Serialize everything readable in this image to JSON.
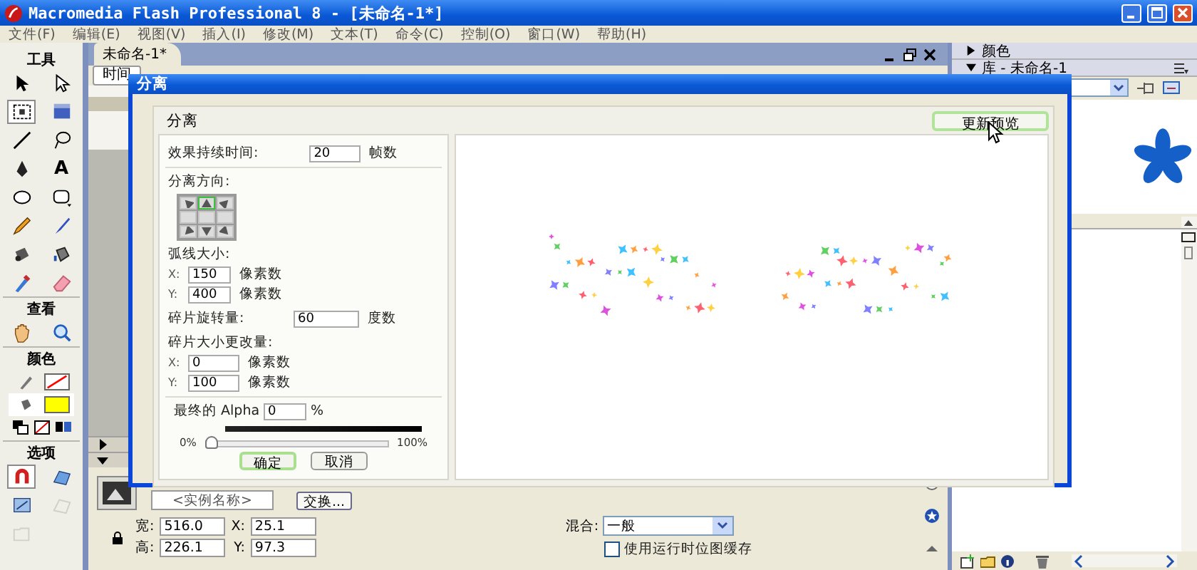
{
  "window": {
    "title": "Macromedia Flash Professional 8 - [未命名-1*]"
  },
  "menu": [
    "文件(F)",
    "编辑(E)",
    "视图(V)",
    "插入(I)",
    "修改(M)",
    "文本(T)",
    "命令(C)",
    "控制(O)",
    "窗口(W)",
    "帮助(H)"
  ],
  "tools": {
    "title": "工具",
    "items": [
      {
        "kind": "arrow",
        "selected": false
      },
      {
        "kind": "subselect",
        "selected": false
      },
      {
        "kind": "transform",
        "selected": true
      },
      {
        "kind": "gradient",
        "selected": false
      },
      {
        "kind": "line",
        "selected": false
      },
      {
        "kind": "lasso",
        "selected": false
      },
      {
        "kind": "pen",
        "selected": false
      },
      {
        "kind": "text",
        "glyph": "A",
        "selected": false
      },
      {
        "kind": "oval",
        "selected": false
      },
      {
        "kind": "polystar",
        "selected": false
      },
      {
        "kind": "pencil",
        "selected": false
      },
      {
        "kind": "brush",
        "selected": false
      },
      {
        "kind": "inkbottle",
        "selected": false
      },
      {
        "kind": "bucket",
        "selected": false
      },
      {
        "kind": "eyedropper",
        "selected": false
      },
      {
        "kind": "eraser",
        "selected": false
      }
    ],
    "view_title": "查看",
    "view_items": [
      {
        "kind": "hand",
        "selected": false
      },
      {
        "kind": "zoom",
        "selected": false
      }
    ],
    "color_title": "颜色",
    "swatches": [
      {
        "kind": "stroke",
        "color": "#ff0000"
      },
      {
        "kind": "fill",
        "color": "#ffff00"
      }
    ],
    "options_title": "选项",
    "options": [
      {
        "kind": "magnet",
        "selected": true,
        "disabled": false
      },
      {
        "kind": "smooth",
        "selected": false,
        "disabled": false
      },
      {
        "kind": "straighten",
        "selected": false,
        "disabled": false
      },
      {
        "kind": "shape",
        "selected": false,
        "disabled": true
      },
      {
        "kind": "folder",
        "selected": false,
        "disabled": true
      }
    ]
  },
  "document": {
    "tab": "未命名-1*",
    "timeline_button": "时间"
  },
  "properties": {
    "instance_placeholder": "<实例名称>",
    "swap_button": "交换...",
    "size_fields": [
      {
        "label": "宽:",
        "value": "516.0"
      },
      {
        "label": "X:",
        "value": "25.1"
      },
      {
        "label": "高:",
        "value": "226.1"
      },
      {
        "label": "Y:",
        "value": "97.3"
      }
    ],
    "blend_label": "混合:",
    "blend_value": "一般",
    "cache_checkbox": {
      "label": "使用运行时位图缓存",
      "checked": false
    }
  },
  "panels": [
    {
      "title": "颜色",
      "expanded": false
    },
    {
      "title": "库 - 未命名-1",
      "expanded": true
    }
  ],
  "dialog": {
    "title": "分离",
    "heading": "分离",
    "update_button": "更新预览",
    "duration": {
      "label": "效果持续时间:",
      "value": "20",
      "unit": "帧数"
    },
    "direction": {
      "label": "分离方向:",
      "cells": [
        {
          "kind": "up-left",
          "selected": false
        },
        {
          "kind": "up",
          "selected": true
        },
        {
          "kind": "up-right",
          "selected": false
        },
        {
          "kind": "none",
          "selected": false
        },
        {
          "kind": "none",
          "selected": false
        },
        {
          "kind": "none",
          "selected": false
        },
        {
          "kind": "down-left",
          "selected": false
        },
        {
          "kind": "down",
          "selected": false
        },
        {
          "kind": "down-right",
          "selected": false
        }
      ]
    },
    "arc": {
      "label": "弧线大小:",
      "fields": [
        {
          "axis": "X:",
          "value": "150",
          "unit": "像素数"
        },
        {
          "axis": "Y:",
          "value": "400",
          "unit": "像素数"
        }
      ]
    },
    "rotation": {
      "label": "碎片旋转量:",
      "value": "60",
      "unit": "度数"
    },
    "size_change": {
      "label": "碎片大小更改量:",
      "fields": [
        {
          "axis": "X:",
          "value": "0",
          "unit": "像素数"
        },
        {
          "axis": "Y:",
          "value": "100",
          "unit": "像素数"
        }
      ]
    },
    "alpha": {
      "label": "最终的 Alpha",
      "value": "0",
      "unit": "%",
      "min_label": "0%",
      "max_label": "100%",
      "level": 0
    },
    "buttons": [
      {
        "label": "确定",
        "default": true
      },
      {
        "label": "取消",
        "default": false
      }
    ]
  }
}
